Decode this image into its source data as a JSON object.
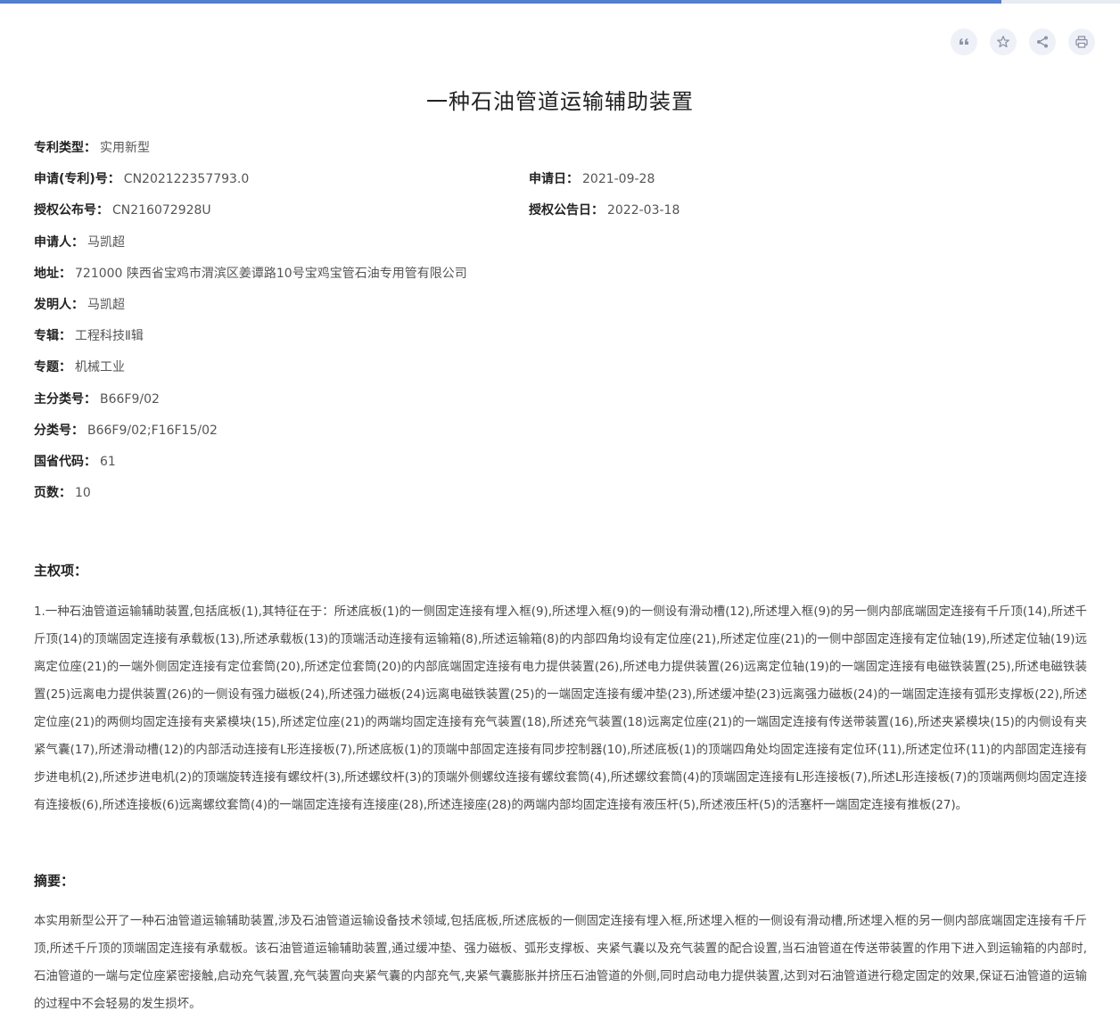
{
  "progress": {
    "fraction": 0.894
  },
  "toolbar": [
    {
      "name": "quote-icon",
      "title": "引用"
    },
    {
      "name": "star-icon",
      "title": "收藏"
    },
    {
      "name": "share-icon",
      "title": "分享"
    },
    {
      "name": "print-icon",
      "title": "打印"
    }
  ],
  "title": "一种石油管道运输辅助装置",
  "meta": {
    "patent_type": {
      "label": "专利类型：",
      "value": "实用新型"
    },
    "application_no": {
      "label": "申请(专利)号：",
      "value": "CN202122357793.0"
    },
    "application_date": {
      "label": "申请日：",
      "value": "2021-09-28"
    },
    "publication_no": {
      "label": "授权公布号：",
      "value": "CN216072928U"
    },
    "publication_date": {
      "label": "授权公告日：",
      "value": "2022-03-18"
    },
    "applicant": {
      "label": "申请人：",
      "value": "马凯超"
    },
    "address": {
      "label": "地址：",
      "value": "721000 陕西省宝鸡市渭滨区姜谭路10号宝鸡宝管石油专用管有限公司"
    },
    "inventor": {
      "label": "发明人：",
      "value": "马凯超"
    },
    "series": {
      "label": "专辑：",
      "value": "工程科技Ⅱ辑"
    },
    "topic": {
      "label": "专题：",
      "value": "机械工业"
    },
    "main_class": {
      "label": "主分类号：",
      "value": "B66F9/02"
    },
    "classes": {
      "label": "分类号：",
      "value": "B66F9/02;F16F15/02"
    },
    "province_code": {
      "label": "国省代码：",
      "value": "61"
    },
    "pages": {
      "label": "页数：",
      "value": "10"
    }
  },
  "claims": {
    "heading": "主权项：",
    "text": "1.一种石油管道运输辅助装置,包括底板(1),其特征在于：所述底板(1)的一侧固定连接有埋入框(9),所述埋入框(9)的一侧设有滑动槽(12),所述埋入框(9)的另一侧内部底端固定连接有千斤顶(14),所述千斤顶(14)的顶端固定连接有承载板(13),所述承载板(13)的顶端活动连接有运输箱(8),所述运输箱(8)的内部四角均设有定位座(21),所述定位座(21)的一侧中部固定连接有定位轴(19),所述定位轴(19)远离定位座(21)的一端外侧固定连接有定位套筒(20),所述定位套筒(20)的内部底端固定连接有电力提供装置(26),所述电力提供装置(26)远离定位轴(19)的一端固定连接有电磁铁装置(25),所述电磁铁装置(25)远离电力提供装置(26)的一侧设有强力磁板(24),所述强力磁板(24)远离电磁铁装置(25)的一端固定连接有缓冲垫(23),所述缓冲垫(23)远离强力磁板(24)的一端固定连接有弧形支撑板(22),所述定位座(21)的两侧均固定连接有夹紧模块(15),所述定位座(21)的两端均固定连接有充气装置(18),所述充气装置(18)远离定位座(21)的一端固定连接有传送带装置(16),所述夹紧模块(15)的内侧设有夹紧气囊(17),所述滑动槽(12)的内部活动连接有L形连接板(7),所述底板(1)的顶端中部固定连接有同步控制器(10),所述底板(1)的顶端四角处均固定连接有定位环(11),所述定位环(11)的内部固定连接有步进电机(2),所述步进电机(2)的顶端旋转连接有螺纹杆(3),所述螺纹杆(3)的顶端外侧螺纹连接有螺纹套筒(4),所述螺纹套筒(4)的顶端固定连接有L形连接板(7),所述L形连接板(7)的顶端两侧均固定连接有连接板(6),所述连接板(6)远离螺纹套筒(4)的一端固定连接有连接座(28),所述连接座(28)的两端内部均固定连接有液压杆(5),所述液压杆(5)的活塞杆一端固定连接有推板(27)。"
  },
  "abstract": {
    "heading": "摘要：",
    "text": "本实用新型公开了一种石油管道运输辅助装置,涉及石油管道运输设备技术领域,包括底板,所述底板的一侧固定连接有埋入框,所述埋入框的一侧设有滑动槽,所述埋入框的另一侧内部底端固定连接有千斤顶,所述千斤顶的顶端固定连接有承载板。该石油管道运输辅助装置,通过缓冲垫、强力磁板、弧形支撑板、夹紧气囊以及充气装置的配合设置,当石油管道在传送带装置的作用下进入到运输箱的内部时,石油管道的一端与定位座紧密接触,启动充气装置,充气装置向夹紧气囊的内部充气,夹紧气囊膨胀并挤压石油管道的外侧,同时启动电力提供装置,达到对石油管道进行稳定固定的效果,保证石油管道的运输的过程中不会轻易的发生损坏。"
  }
}
